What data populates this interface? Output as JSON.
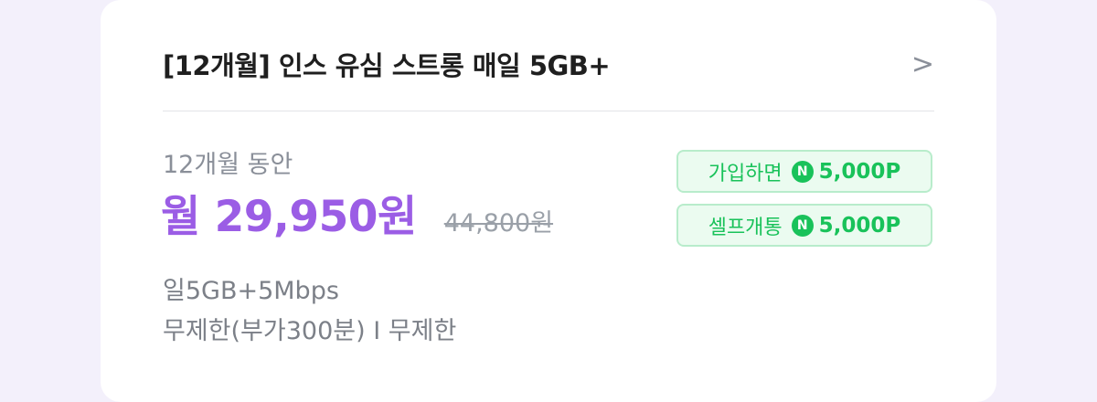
{
  "plan": {
    "title": "[12개월] 인스 유심 스트롱 매일 5GB+",
    "chevron": ">",
    "duration": "12개월 동안",
    "price": "월 29,950원",
    "original_price": "44,800원",
    "feature_line1": "일5GB+5Mbps",
    "feature_line2": "무제한(부가300분) I 무제한"
  },
  "badges": [
    {
      "label": "가입하면",
      "icon": "N",
      "points": "5,000P"
    },
    {
      "label": "셀프개통",
      "icon": "N",
      "points": "5,000P"
    }
  ],
  "colors": {
    "accent_purple": "#9b5de5",
    "point_green": "#19c25a",
    "badge_bg": "#ebfbf0",
    "badge_border": "#b8eccb"
  }
}
